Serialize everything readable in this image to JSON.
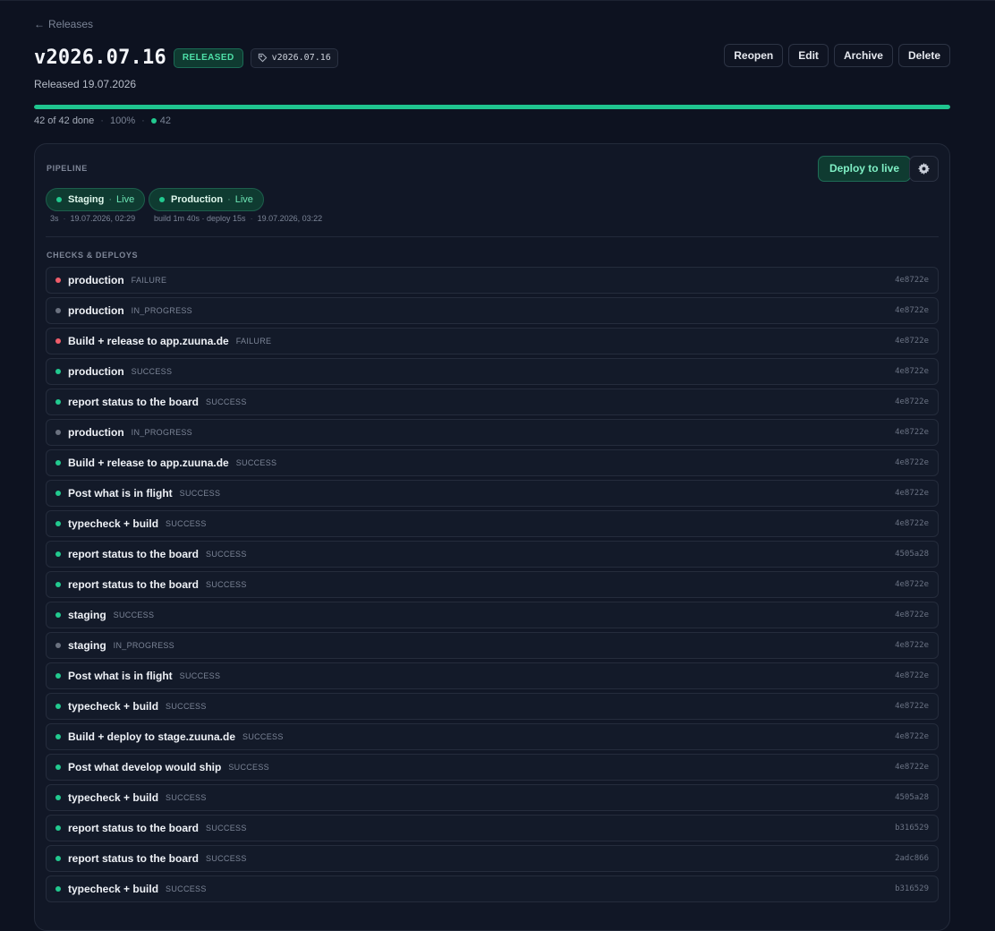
{
  "nav": {
    "back_label": "Releases"
  },
  "release": {
    "title": "v2026.07.16",
    "badge": "RELEASED",
    "tag": "v2026.07.16",
    "released_text": "Released 19.07.2026"
  },
  "actions": {
    "reopen": "Reopen",
    "edit": "Edit",
    "archive": "Archive",
    "delete": "Delete"
  },
  "progress": {
    "done_text": "42 of 42 done",
    "percent_text": "100%",
    "count": "42",
    "fraction": 1.0
  },
  "pipeline": {
    "label": "PIPELINE",
    "deploy_label": "Deploy to live",
    "stages": [
      {
        "name": "Staging",
        "status": "Live",
        "meta": [
          "3s",
          "19.07.2026, 02:29"
        ]
      },
      {
        "name": "Production",
        "status": "Live",
        "meta": [
          "build 1m 40s · deploy 15s",
          "19.07.2026, 03:22"
        ]
      }
    ]
  },
  "checks": {
    "label": "CHECKS & DEPLOYS",
    "rows": [
      {
        "name": "production",
        "status": "FAILURE",
        "sha": "4e8722e",
        "state": "red"
      },
      {
        "name": "production",
        "status": "IN_PROGRESS",
        "sha": "4e8722e",
        "state": "gray"
      },
      {
        "name": "Build + release to app.zuuna.de",
        "status": "FAILURE",
        "sha": "4e8722e",
        "state": "red"
      },
      {
        "name": "production",
        "status": "SUCCESS",
        "sha": "4e8722e",
        "state": "green"
      },
      {
        "name": "report status to the board",
        "status": "SUCCESS",
        "sha": "4e8722e",
        "state": "green"
      },
      {
        "name": "production",
        "status": "IN_PROGRESS",
        "sha": "4e8722e",
        "state": "gray"
      },
      {
        "name": "Build + release to app.zuuna.de",
        "status": "SUCCESS",
        "sha": "4e8722e",
        "state": "green"
      },
      {
        "name": "Post what is in flight",
        "status": "SUCCESS",
        "sha": "4e8722e",
        "state": "green"
      },
      {
        "name": "typecheck + build",
        "status": "SUCCESS",
        "sha": "4e8722e",
        "state": "green"
      },
      {
        "name": "report status to the board",
        "status": "SUCCESS",
        "sha": "4505a28",
        "state": "green"
      },
      {
        "name": "report status to the board",
        "status": "SUCCESS",
        "sha": "4e8722e",
        "state": "green"
      },
      {
        "name": "staging",
        "status": "SUCCESS",
        "sha": "4e8722e",
        "state": "green"
      },
      {
        "name": "staging",
        "status": "IN_PROGRESS",
        "sha": "4e8722e",
        "state": "gray"
      },
      {
        "name": "Post what is in flight",
        "status": "SUCCESS",
        "sha": "4e8722e",
        "state": "green"
      },
      {
        "name": "typecheck + build",
        "status": "SUCCESS",
        "sha": "4e8722e",
        "state": "green"
      },
      {
        "name": "Build + deploy to stage.zuuna.de",
        "status": "SUCCESS",
        "sha": "4e8722e",
        "state": "green"
      },
      {
        "name": "Post what develop would ship",
        "status": "SUCCESS",
        "sha": "4e8722e",
        "state": "green"
      },
      {
        "name": "typecheck + build",
        "status": "SUCCESS",
        "sha": "4505a28",
        "state": "green"
      },
      {
        "name": "report status to the board",
        "status": "SUCCESS",
        "sha": "b316529",
        "state": "green"
      },
      {
        "name": "report status to the board",
        "status": "SUCCESS",
        "sha": "2adc866",
        "state": "green"
      },
      {
        "name": "typecheck + build",
        "status": "SUCCESS",
        "sha": "b316529",
        "state": "green"
      }
    ]
  },
  "colors": {
    "success": "#22c98f",
    "failure": "#ef5d6a",
    "in_progress": "#6b7280",
    "accent": "#1fc58f"
  },
  "icons": {
    "back": "arrow-left-icon",
    "tag": "tag-icon",
    "settings": "gear-icon"
  }
}
